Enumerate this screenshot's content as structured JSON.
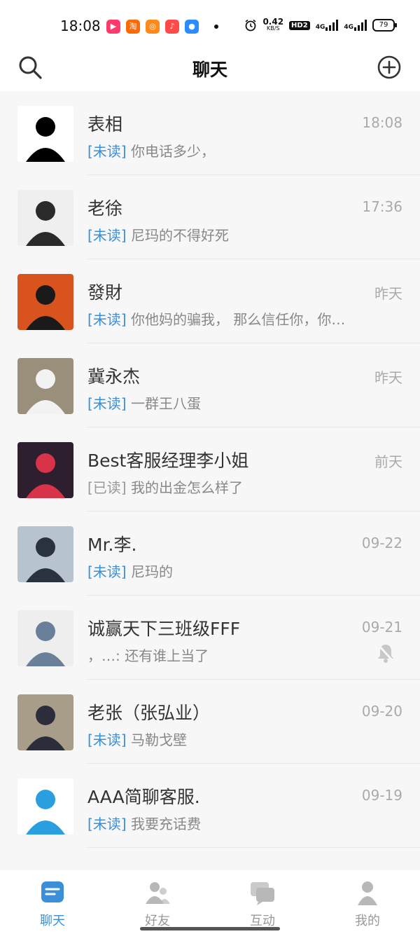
{
  "status_bar": {
    "time": "18:08",
    "app_icons": [
      {
        "name": "video-app-icon",
        "glyph": "▶",
        "color": "#ff3b6b"
      },
      {
        "name": "taobao-app-icon",
        "glyph": "淘",
        "color": "#ff6a00"
      },
      {
        "name": "orange-app-icon",
        "glyph": "◎",
        "color": "#ff8a1a"
      },
      {
        "name": "music-app-icon",
        "glyph": "♪",
        "color": "#ff4a4a"
      },
      {
        "name": "blue-app-icon",
        "glyph": "●",
        "color": "#2a8cff"
      }
    ],
    "net_speed": "0.42",
    "net_unit": "KB/S",
    "hd_label": "HD2",
    "signal_1": "4G",
    "signal_2": "4G",
    "battery": "79"
  },
  "header": {
    "title": "聊天"
  },
  "chats": [
    {
      "name": "表相",
      "time": "18:08",
      "tag": "[未读]",
      "tag_type": "unread",
      "message": "你电话多少，",
      "muted": false,
      "avatar": {
        "bg": "#ffffff",
        "fg": "#000000"
      }
    },
    {
      "name": "老徐",
      "time": "17:36",
      "tag": "[未读]",
      "tag_type": "unread",
      "message": "尼玛的不得好死",
      "muted": false,
      "avatar": {
        "bg": "#efefef",
        "fg": "#2a2a2a"
      }
    },
    {
      "name": "發財",
      "time": "昨天",
      "tag": "[未读]",
      "tag_type": "unread",
      "message": "你他妈的骗我， 那么信任你，你…",
      "muted": false,
      "avatar": {
        "bg": "#d9531e",
        "fg": "#1a1a1a"
      }
    },
    {
      "name": "冀永杰",
      "time": "昨天",
      "tag": "[未读]",
      "tag_type": "unread",
      "message": "一群王八蛋",
      "muted": false,
      "avatar": {
        "bg": "#9a8f7a",
        "fg": "#f2f2f2"
      }
    },
    {
      "name": "Best客服经理李小姐",
      "time": "前天",
      "tag": "[已读]",
      "tag_type": "read",
      "message": "我的出金怎么样了",
      "muted": false,
      "avatar": {
        "bg": "#2d1f2e",
        "fg": "#d9334a"
      }
    },
    {
      "name": "Mr.李.",
      "time": "09-22",
      "tag": "[未读]",
      "tag_type": "unread",
      "message": "尼玛的",
      "muted": false,
      "avatar": {
        "bg": "#b7c4cf",
        "fg": "#2a3240"
      }
    },
    {
      "name": "诚赢天下三班级FFF",
      "time": "09-21",
      "tag": "",
      "tag_type": "none",
      "message": "，…: 还有谁上当了",
      "muted": true,
      "avatar": {
        "bg": "#eeeeee",
        "fg": "#6a7f99"
      }
    },
    {
      "name": "老张（张弘业）",
      "time": "09-20",
      "tag": "[未读]",
      "tag_type": "unread",
      "message": "马勒戈壁",
      "muted": false,
      "avatar": {
        "bg": "#a89d88",
        "fg": "#2b2e3a"
      }
    },
    {
      "name": "AAA简聊客服.",
      "time": "09-19",
      "tag": "[未读]",
      "tag_type": "unread",
      "message": "我要充话费",
      "muted": false,
      "avatar": {
        "bg": "#ffffff",
        "fg": "#2a9fe0"
      }
    }
  ],
  "bottom_nav": [
    {
      "label": "聊天",
      "icon": "chat-icon",
      "active": true
    },
    {
      "label": "好友",
      "icon": "friends-icon",
      "active": false
    },
    {
      "label": "互动",
      "icon": "interaction-icon",
      "active": false
    },
    {
      "label": "我的",
      "icon": "profile-icon",
      "active": false
    }
  ],
  "colors": {
    "accent": "#3a8fd8",
    "unread_tag": "#3a8fd8",
    "time_text": "#aaaaaa",
    "list_bg": "#f7f7f7"
  }
}
